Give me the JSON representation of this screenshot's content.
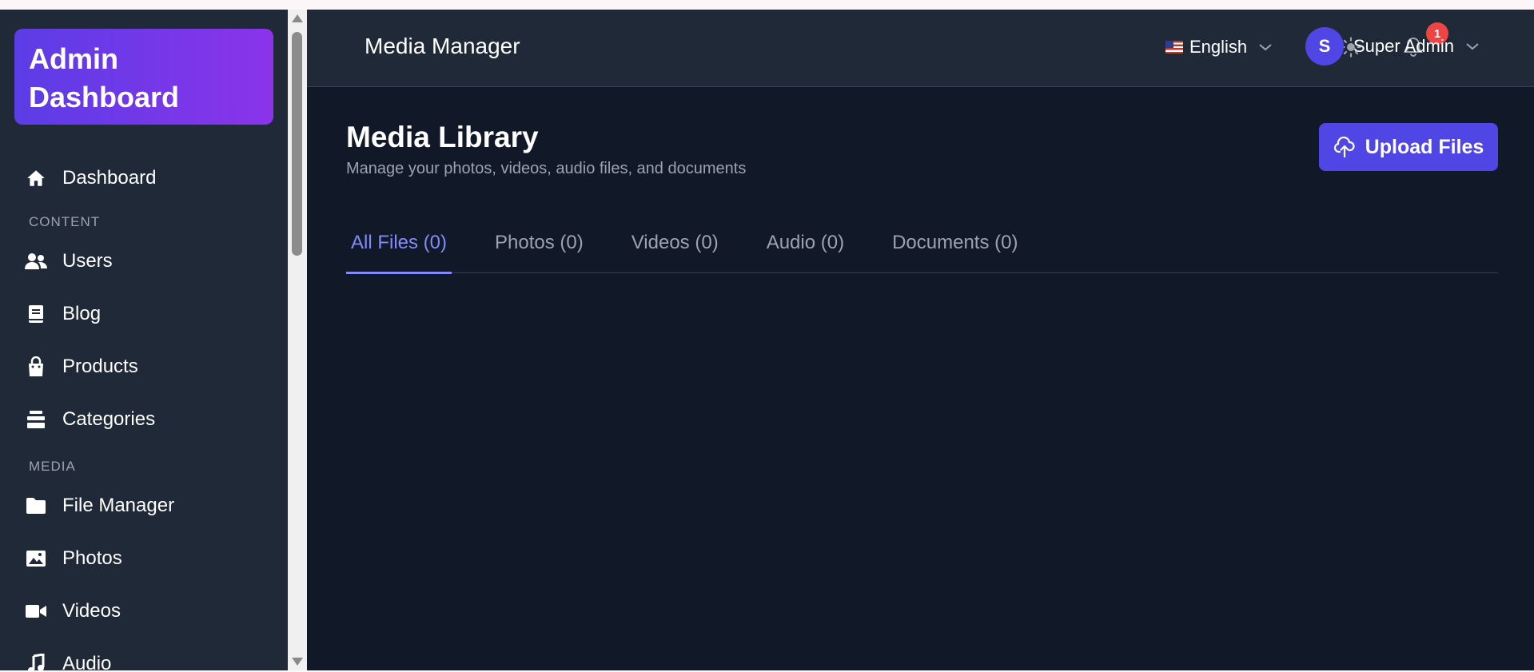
{
  "brand": {
    "line1": "Admin",
    "line2": "Dashboard"
  },
  "sidebar": {
    "dashboard": "Dashboard",
    "section_content": "CONTENT",
    "content_items": [
      "Users",
      "Blog",
      "Products",
      "Categories"
    ],
    "section_media": "MEDIA",
    "media_items": [
      "File Manager",
      "Photos",
      "Videos",
      "Audio"
    ]
  },
  "header": {
    "title": "Media Manager",
    "notifications_count": "1",
    "language": "English",
    "user_initial": "S",
    "user_name": "Super Admin"
  },
  "page": {
    "title": "Media Library",
    "subtitle": "Manage your photos, videos, audio files, and documents",
    "upload_label": "Upload Files"
  },
  "tabs": [
    "All Files (0)",
    "Photos (0)",
    "Videos (0)",
    "Audio (0)",
    "Documents (0)"
  ],
  "active_tab": 0,
  "colors": {
    "accent": "#4f46e5",
    "accent_text": "#818cf8",
    "bg_main": "#111827",
    "bg_panel": "#1f2937",
    "badge": "#ef4444"
  },
  "icons": {
    "dashboard": "home-icon",
    "users": "users-icon",
    "blog": "book-icon",
    "products": "shopping-bag-icon",
    "categories": "layers-icon",
    "file_manager": "folder-icon",
    "photos": "image-icon",
    "videos": "video-icon",
    "audio": "music-icon",
    "theme": "sun-icon",
    "notifications": "bell-icon",
    "upload": "cloud-upload-icon"
  }
}
